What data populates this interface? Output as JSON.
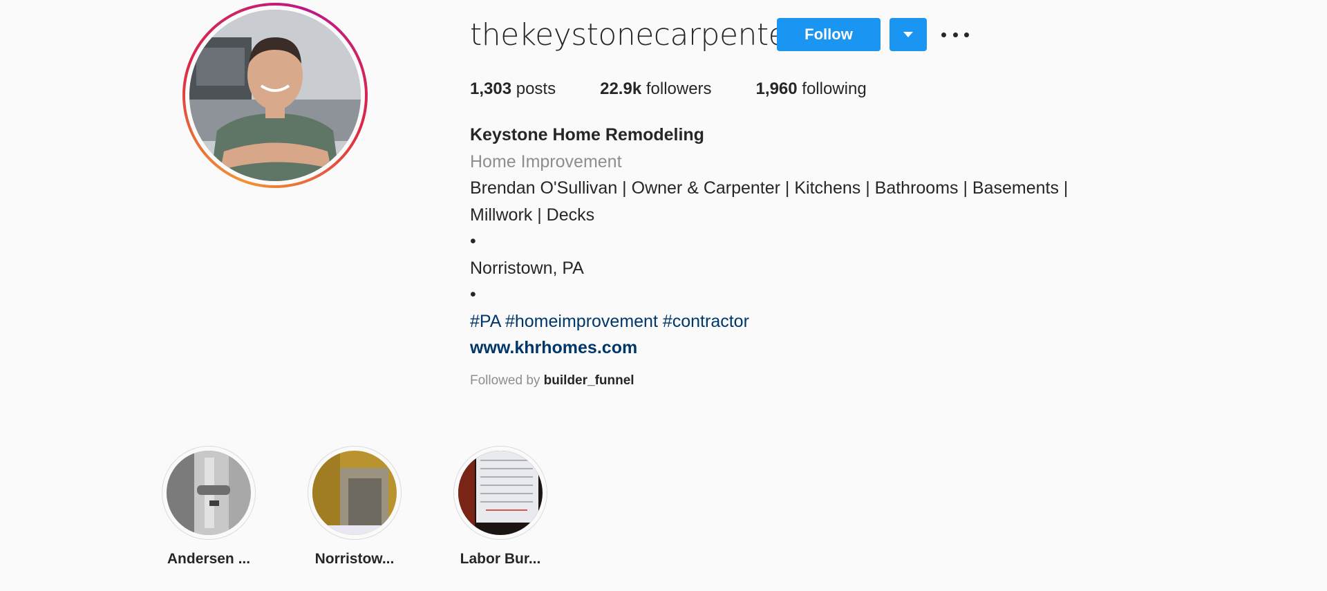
{
  "profile": {
    "username": "thekeystonecarpenter",
    "follow_label": "Follow",
    "stats": {
      "posts_count": "1,303",
      "posts_label": "posts",
      "followers_count": "22.9k",
      "followers_label": "followers",
      "following_count": "1,960",
      "following_label": "following"
    },
    "bio": {
      "full_name": "Keystone Home Remodeling",
      "category": "Home Improvement",
      "line1": "Brendan O'Sullivan | Owner & Carpenter | Kitchens | Bathrooms | Basements |",
      "line2": "Millwork | Decks",
      "bullet1": "•",
      "location": "Norristown, PA",
      "bullet2": "•",
      "hashtags": "#PA #homeimprovement #contractor",
      "website": "www.khrhomes.com"
    },
    "followed_by_prefix": "Followed by",
    "followed_by_user": "builder_funnel"
  },
  "highlights": [
    {
      "label": "Andersen ..."
    },
    {
      "label": "Norristow..."
    },
    {
      "label": "Labor Bur..."
    }
  ],
  "colors": {
    "follow_button": "#1a95f2",
    "link": "#00376b",
    "muted": "#8e8e8e"
  }
}
